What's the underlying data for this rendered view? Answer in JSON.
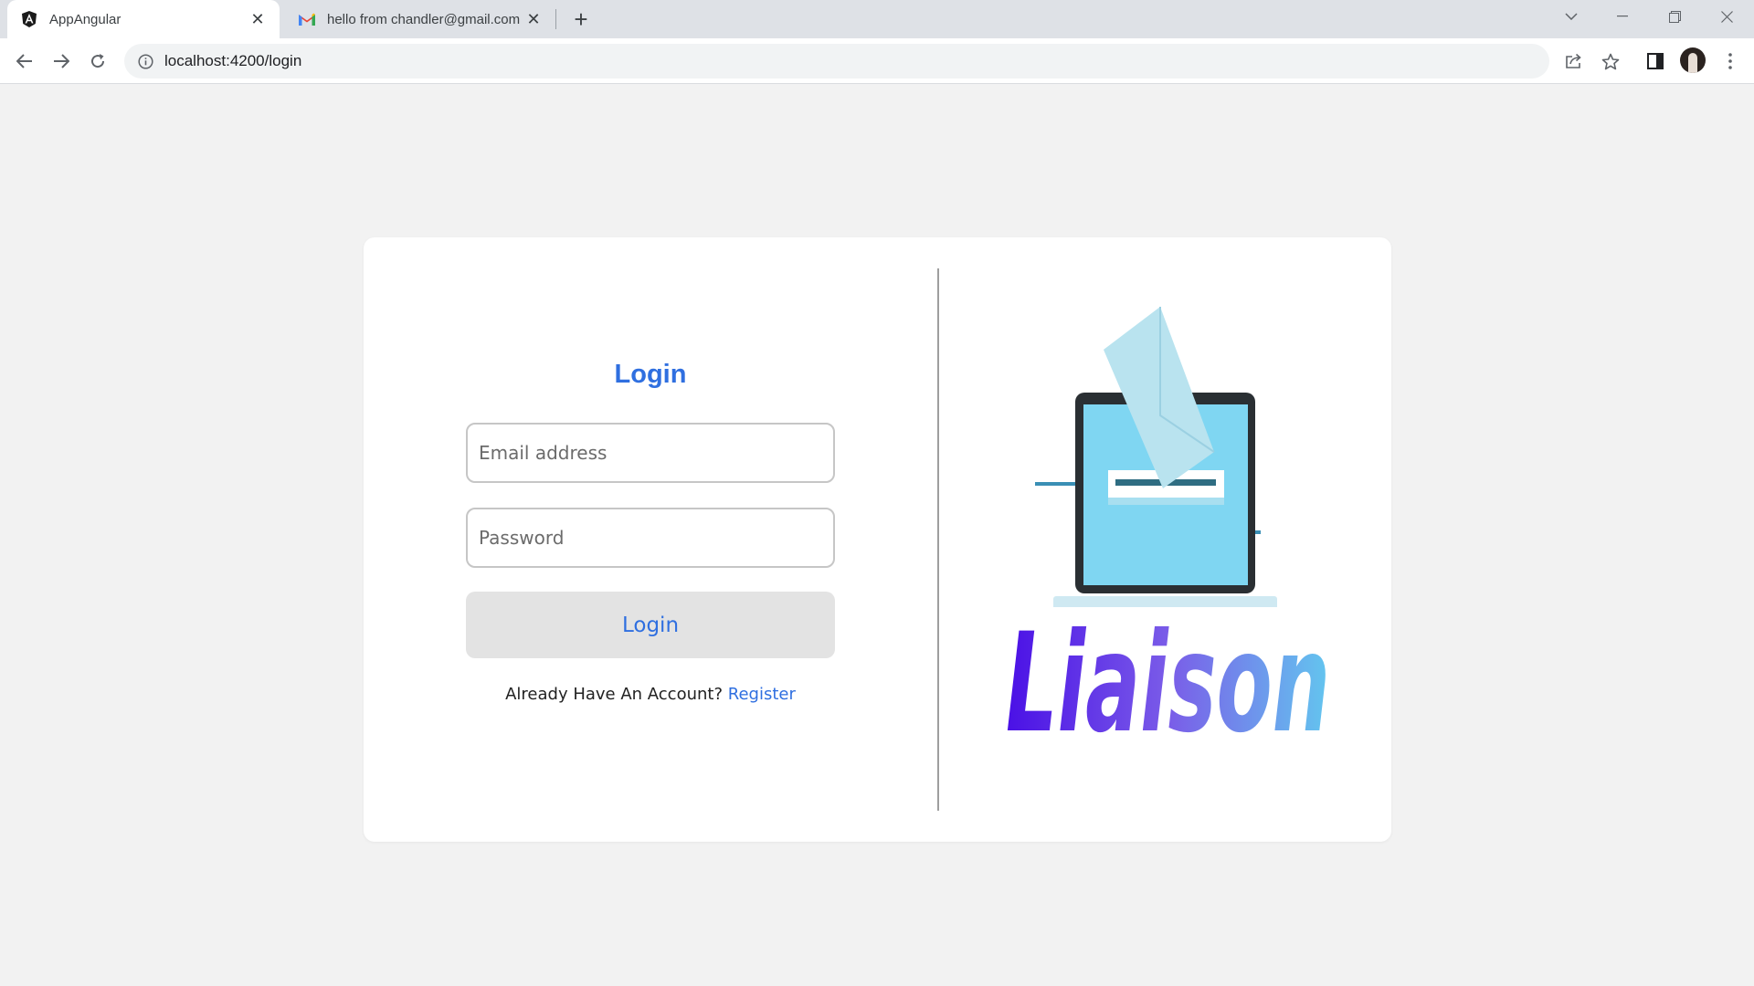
{
  "browser": {
    "tabs": [
      {
        "title": "AppAngular",
        "icon": "angular-icon",
        "active": true
      },
      {
        "title": "hello from chandler@gmail.com",
        "icon": "gmail-icon",
        "active": false
      }
    ],
    "url": "localhost:4200/login"
  },
  "login": {
    "title": "Login",
    "email_placeholder": "Email address",
    "password_placeholder": "Password",
    "button_label": "Login",
    "account_prompt": "Already Have An Account?",
    "register_link": "Register"
  },
  "brand": {
    "logo_text": "Liaison",
    "gradient": [
      "#4a10e6",
      "#7a5ce8",
      "#63c6ef"
    ]
  },
  "colors": {
    "accent": "#2f6fe0",
    "page_bg": "#f2f2f2",
    "card_bg": "#ffffff",
    "button_bg": "#e3e3e3"
  }
}
